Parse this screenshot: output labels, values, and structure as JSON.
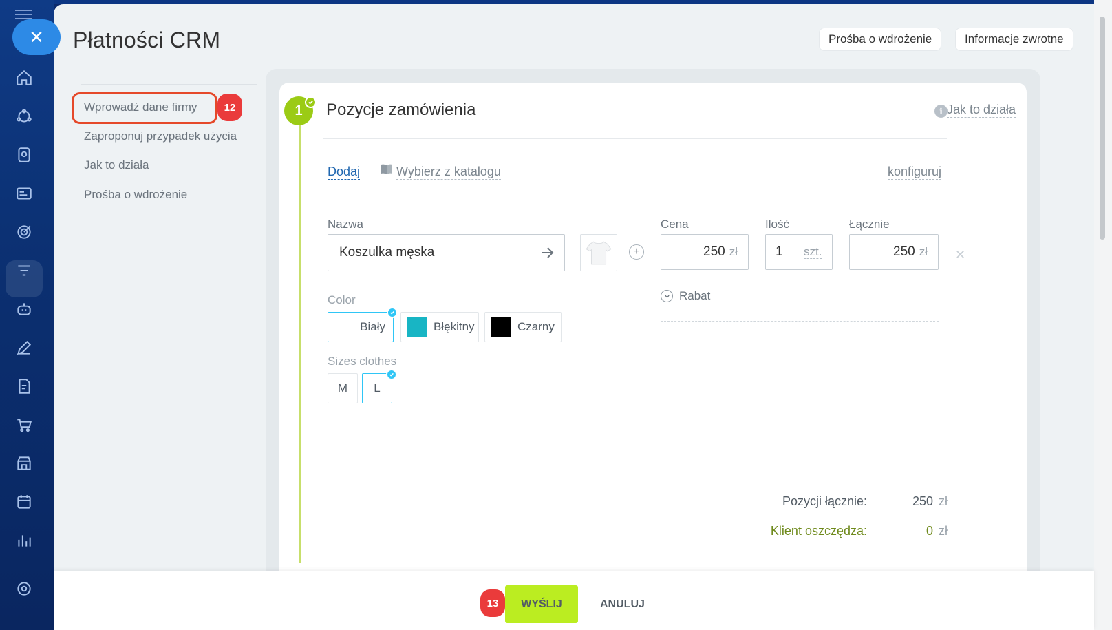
{
  "app": {
    "title": "Płatności CRM",
    "header_buttons": [
      "Prośba o wdrożenie",
      "Informacje zwrotne"
    ]
  },
  "sidebar_icons": [
    "home-icon",
    "workflow-icon",
    "contacts-icon",
    "id-card-icon",
    "target-icon",
    "funnel-icon",
    "robot-icon",
    "pen-icon",
    "document-icon",
    "cart-icon",
    "store-icon",
    "calendar-icon",
    "analytics-icon",
    "settings-icon"
  ],
  "nav": {
    "items": [
      {
        "label": "Wprowadź dane firmy",
        "highlighted": true
      },
      {
        "label": "Zaproponuj przypadek użycia"
      },
      {
        "label": "Jak to działa"
      },
      {
        "label": "Prośba o wdrożenie"
      }
    ]
  },
  "badges": {
    "nav_step": "12",
    "send_step": "13"
  },
  "section": {
    "step_number": "1",
    "title": "Pozycje zamówienia",
    "help_link": "Jak to działa",
    "info_glyph": "i"
  },
  "toolbar": {
    "add_label": "Dodaj",
    "catalog_label": "Wybierz z katalogu",
    "configure_label": "konfiguruj"
  },
  "product": {
    "name_label": "Nazwa",
    "name_value": "Koszulka męska",
    "price_label": "Cena",
    "price_value": "250",
    "currency": "zł",
    "qty_label": "Ilość",
    "qty_value": "1",
    "qty_unit": "szt.",
    "total_label": "Łącznie",
    "total_value": "250",
    "discount_label": "Rabat",
    "color_label": "Color",
    "colors": [
      {
        "label": "Biały",
        "hex": "#ffffff",
        "selected": true
      },
      {
        "label": "Błękitny",
        "hex": "#18b5c4",
        "selected": false
      },
      {
        "label": "Czarny",
        "hex": "#000000",
        "selected": false
      }
    ],
    "size_label": "Sizes clothes",
    "sizes": [
      {
        "label": "M",
        "selected": false
      },
      {
        "label": "L",
        "selected": true
      }
    ]
  },
  "summary": {
    "items_total_label": "Pozycji łącznie:",
    "items_total_value": "250",
    "savings_label": "Klient oszczędza:",
    "savings_value": "0",
    "currency": "zł"
  },
  "footer": {
    "send_label": "WYŚLIJ",
    "cancel_label": "ANULUJ"
  },
  "colors": {
    "accent_green": "#9bcb15",
    "send_button": "#bbed21",
    "badge_red": "#ea3b3b",
    "highlight_border": "#e5492a",
    "selection_blue": "#2fc6f6",
    "sidebar_bg": "#0f3b86",
    "close_button": "#2d8ae6"
  }
}
